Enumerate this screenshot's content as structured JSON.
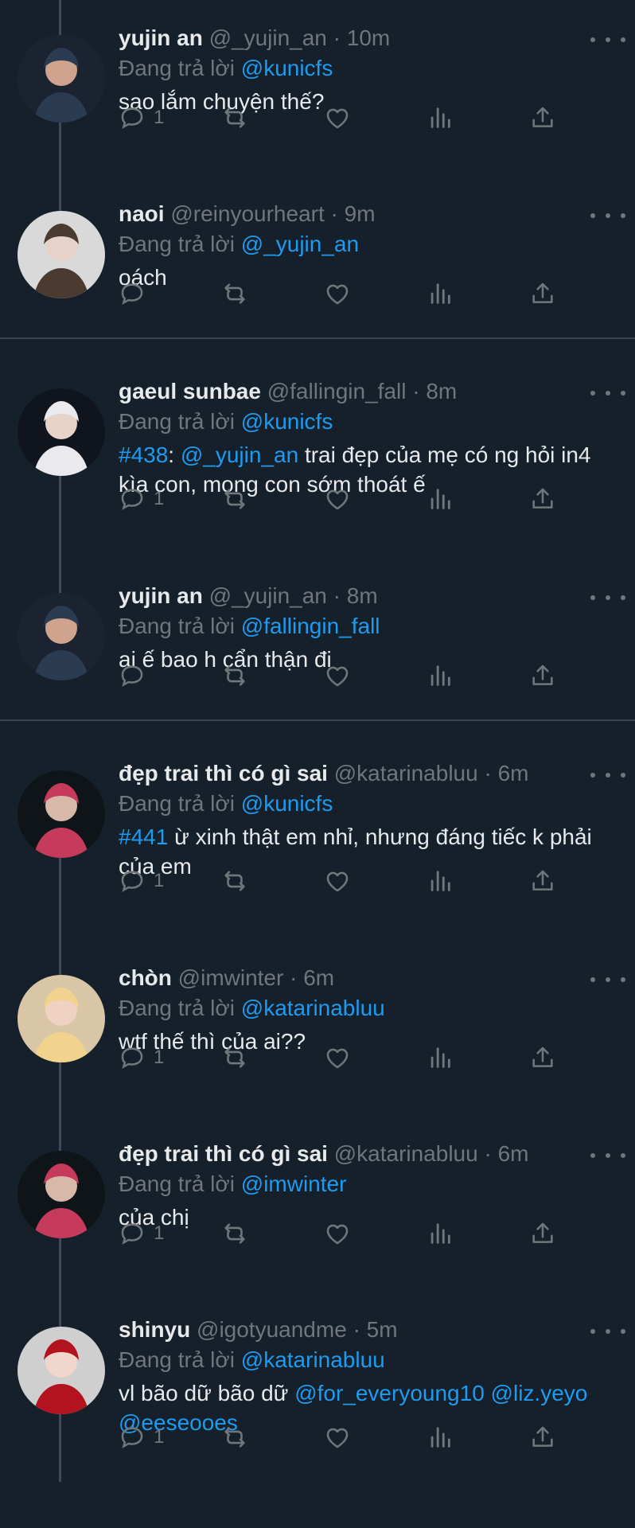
{
  "replying_prefix": "Đang trả lời",
  "dot": "·",
  "colors": {
    "background": "#15202b",
    "accent": "#1d9bf0",
    "muted": "#71767b",
    "text": "#e7e9ea",
    "separator": "#38444d"
  },
  "icons": {
    "reply": "reply-icon",
    "retweet": "retweet-icon",
    "like": "heart-icon",
    "views": "views-icon",
    "share": "share-icon",
    "more": "more-icon"
  },
  "tweets": [
    {
      "name": "yujin an",
      "handle": "@_yujin_an",
      "time": "10m",
      "replying_to": "@kunicfs",
      "text_parts": [
        {
          "t": "sao lắm chuyện thế?"
        }
      ],
      "reply_count": "1"
    },
    {
      "name": "naoi",
      "handle": "@reinyourheart",
      "time": "9m",
      "replying_to": "@_yujin_an",
      "text_parts": [
        {
          "t": "oách"
        }
      ],
      "reply_count": ""
    },
    {
      "name": "gaeul sunbae",
      "handle": "@fallingin_fall",
      "time": "8m",
      "replying_to": "@kunicfs",
      "text_parts": [
        {
          "t": "#438",
          "link": true
        },
        {
          "t": ": "
        },
        {
          "t": "@_yujin_an",
          "link": true
        },
        {
          "t": " trai đẹp của mẹ có ng hỏi in4 kìa con, mong con sớm thoát ế"
        }
      ],
      "reply_count": "1"
    },
    {
      "name": "yujin an",
      "handle": "@_yujin_an",
      "time": "8m",
      "replying_to": "@fallingin_fall",
      "text_parts": [
        {
          "t": "ai ế bao h cẩn thận đi"
        }
      ],
      "reply_count": ""
    },
    {
      "name": "đẹp trai thì có gì sai",
      "handle": "@katarinabluu",
      "time": "6m",
      "replying_to": "@kunicfs",
      "text_parts": [
        {
          "t": "#441",
          "link": true
        },
        {
          "t": " ừ xinh thật em nhỉ, nhưng đáng tiếc k phải của em"
        }
      ],
      "reply_count": "1"
    },
    {
      "name": "chòn",
      "handle": "@imwinter",
      "time": "6m",
      "replying_to": "@katarinabluu",
      "text_parts": [
        {
          "t": "wtf thế thì của ai??"
        }
      ],
      "reply_count": "1"
    },
    {
      "name": "đẹp trai thì có gì sai",
      "handle": "@katarinabluu",
      "time": "6m",
      "replying_to": "@imwinter",
      "text_parts": [
        {
          "t": "của chị"
        }
      ],
      "reply_count": "1"
    },
    {
      "name": "shinyu",
      "handle": "@igotyuandme",
      "time": "5m",
      "replying_to": "@katarinabluu",
      "text_parts": [
        {
          "t": "vl bão dữ bão dữ "
        },
        {
          "t": "@for_everyoung10",
          "link": true
        },
        {
          "t": " "
        },
        {
          "t": "@liz.yeyo",
          "link": true
        },
        {
          "t": " "
        },
        {
          "t": "@eeseooes",
          "link": true
        }
      ],
      "reply_count": "1"
    }
  ]
}
